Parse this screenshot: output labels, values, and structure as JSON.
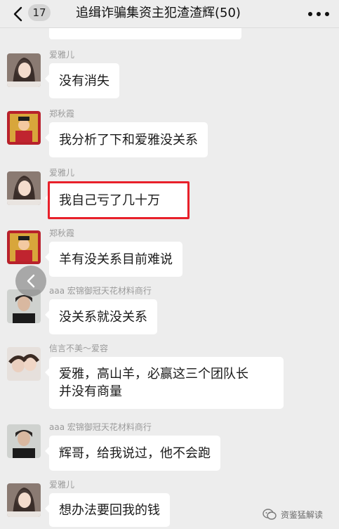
{
  "header": {
    "unread_count": "17",
    "title": "追缉诈骗集资主犯渣渣辉(50)"
  },
  "messages": [
    {
      "sender": "爱雅儿",
      "text": "没有消失"
    },
    {
      "sender": "郑秋霞",
      "text": "我分析了下和爱雅没关系"
    },
    {
      "sender": "爱雅儿",
      "text": "我自己亏了几十万",
      "highlighted": true
    },
    {
      "sender": "郑秋霞",
      "text": "羊有没关系目前难说"
    },
    {
      "sender": "aaa 宏锦御冠天花材料商行",
      "text": "没关系就没关系"
    },
    {
      "sender": "信言不美～爱容",
      "text_line1": "爱雅，高山羊，必赢这三个团队长",
      "text_line2": "并没有商量"
    },
    {
      "sender": "aaa 宏锦御冠天花材料商行",
      "text": "辉哥，给我说过，他不会跑"
    },
    {
      "sender": "爱雅儿",
      "text": "想办法要回我的钱"
    }
  ],
  "watermark": {
    "text": "资鉴猛解读"
  },
  "colors": {
    "background": "#ededed",
    "highlight": "#e8202a",
    "bubble": "#ffffff"
  },
  "icons": [
    "back-chevron-icon",
    "more-dots-icon",
    "nav-left-icon",
    "wechat-icon"
  ]
}
